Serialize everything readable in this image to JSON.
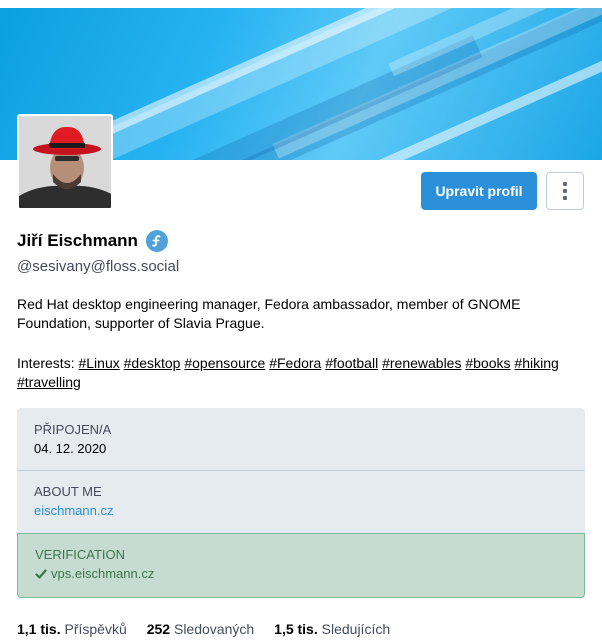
{
  "profile": {
    "display_name": "Jiří Eischmann",
    "handle": "@sesivany@floss.social",
    "bio": "Red Hat desktop engineering manager, Fedora ambassador, member of GNOME Foundation, supporter of Slavia Prague.",
    "interests_label": "Interests:",
    "tags": [
      "#Linux",
      "#desktop",
      "#opensource",
      "#Fedora",
      "#football",
      "#renewables",
      "#books",
      "#hiking",
      "#travelling"
    ]
  },
  "actions": {
    "edit_profile": "Upravit profil"
  },
  "fields": {
    "joined_label": "PŘIPOJEN/A",
    "joined_value": "04. 12. 2020",
    "about_label": "ABOUT ME",
    "about_value": "eischmann.cz",
    "verification_label": "VERIFICATION",
    "verification_value": "vps.eischmann.cz"
  },
  "stats": {
    "posts_count": "1,1 tis.",
    "posts_label": "Příspěvků",
    "following_count": "252",
    "following_label": "Sledovaných",
    "followers_count": "1,5 tis.",
    "followers_label": "Sledujících"
  },
  "colors": {
    "accent": "#2b90d9",
    "link": "#2b90d9",
    "verified_green": "#79bd9a",
    "verified_text": "#3c754d",
    "fedora_badge": "#51a2da"
  }
}
